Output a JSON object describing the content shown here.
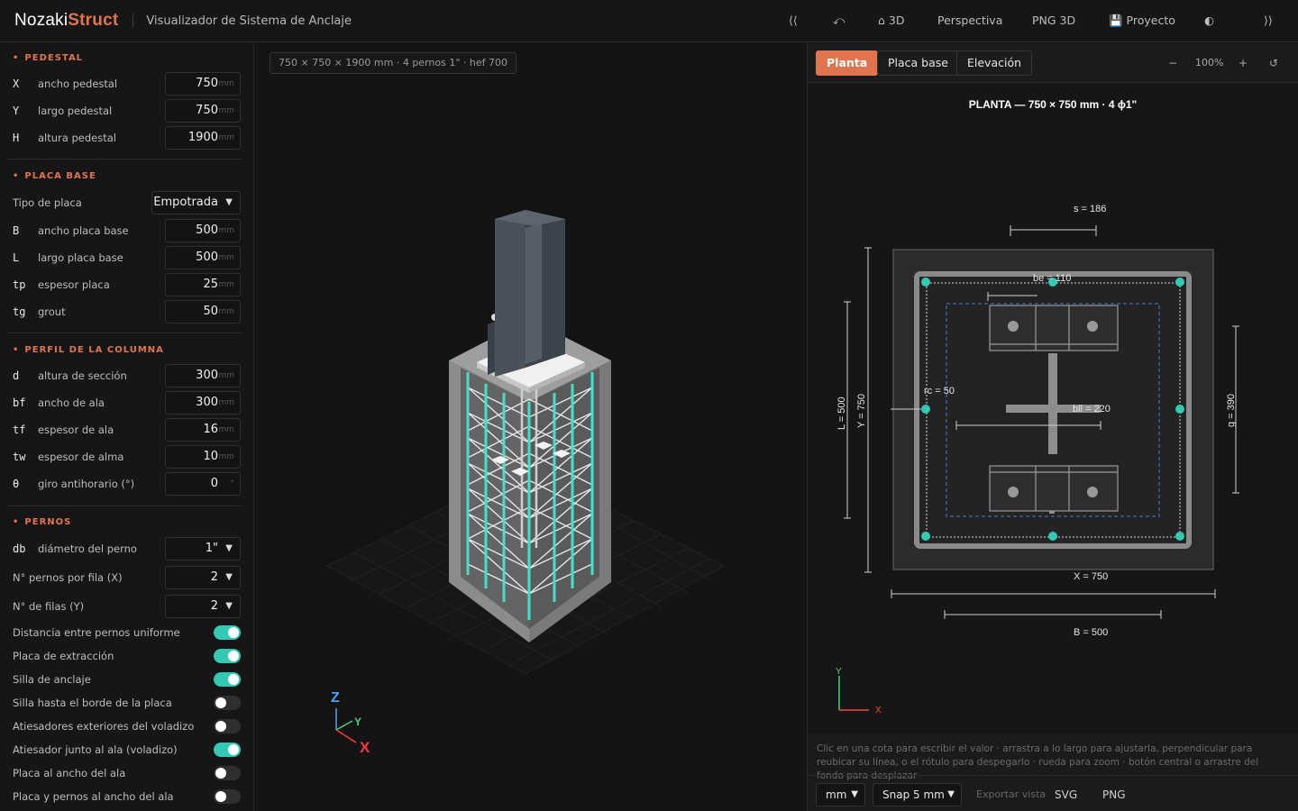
{
  "app": {
    "brand_a": "Nozaki",
    "brand_b": "Struct",
    "subtitle": "Visualizador de Sistema de Anclaje"
  },
  "toolbar": {
    "collapse_left": "⟨⟨",
    "undo": "⤺",
    "view3d": "⌂ 3D",
    "perspective": "Perspectiva",
    "png3d": "PNG 3D",
    "project": "💾 Proyecto",
    "theme": "◐",
    "collapse_right": "⟩⟩"
  },
  "left": {
    "pedestal": {
      "title": "PEDESTAL",
      "rows": [
        {
          "sym": "X",
          "label": "ancho pedestal",
          "value": "750",
          "unit": "mm"
        },
        {
          "sym": "Y",
          "label": "largo pedestal",
          "value": "750",
          "unit": "mm"
        },
        {
          "sym": "H",
          "label": "altura pedestal",
          "value": "1900",
          "unit": "mm"
        }
      ]
    },
    "placa": {
      "title": "PLACA BASE",
      "tipo_label": "Tipo de placa",
      "tipo_value": "Empotrada",
      "rows": [
        {
          "sym": "B",
          "label": "ancho placa base",
          "value": "500",
          "unit": "mm"
        },
        {
          "sym": "L",
          "label": "largo placa base",
          "value": "500",
          "unit": "mm"
        },
        {
          "sym": "tp",
          "label": "espesor placa",
          "value": "25",
          "unit": "mm"
        },
        {
          "sym": "tg",
          "label": "grout",
          "value": "50",
          "unit": "mm"
        }
      ]
    },
    "perfil": {
      "title": "PERFIL DE LA COLUMNA",
      "rows": [
        {
          "sym": "d",
          "label": "altura de sección",
          "value": "300",
          "unit": "mm"
        },
        {
          "sym": "bf",
          "label": "ancho de ala",
          "value": "300",
          "unit": "mm"
        },
        {
          "sym": "tf",
          "label": "espesor de ala",
          "value": "16",
          "unit": "mm"
        },
        {
          "sym": "tw",
          "label": "espesor de alma",
          "value": "10",
          "unit": "mm"
        },
        {
          "sym": "θ",
          "label": "giro antihorario (°)",
          "value": "0",
          "unit": "°"
        }
      ]
    },
    "pernos": {
      "title": "PERNOS",
      "db_sym": "db",
      "db_label": "diámetro del perno",
      "db_value": "1\"",
      "nx_label": "N° pernos por fila (X)",
      "nx_value": "2",
      "ny_label": "N° de filas (Y)",
      "ny_value": "2",
      "toggles": [
        {
          "label": "Distancia entre pernos uniforme",
          "on": true
        },
        {
          "label": "Placa de extracción",
          "on": true
        },
        {
          "label": "Silla de anclaje",
          "on": true
        },
        {
          "label": "Silla hasta el borde de la placa",
          "on": false
        },
        {
          "label": "Atiesadores exteriores del voladizo",
          "on": false
        },
        {
          "label": "Atiesador junto al ala (voladizo)",
          "on": true
        },
        {
          "label": "Placa al ancho del ala",
          "on": false
        },
        {
          "label": "Placa y pernos al ancho del ala",
          "on": false
        }
      ]
    }
  },
  "viewport": {
    "info": "750 × 750 × 1900 mm · 4 pernos 1\" · hef 700",
    "axes": {
      "z": "Z",
      "y": "Y",
      "x": "X"
    }
  },
  "right": {
    "tabs": [
      "Planta",
      "Placa base",
      "Elevación"
    ],
    "zoom_out": "−",
    "zoom": "100%",
    "zoom_in": "+",
    "reset": "↺",
    "drawing_title": "PLANTA — 750 × 750 mm · 4 ϕ1\"",
    "dims": {
      "s": "s = 186",
      "be": "be = 110",
      "rc": "rc = 50",
      "bll": "bll = 220",
      "L": "L = 500",
      "Y": "Y = 750",
      "g": "g = 390",
      "X": "X = 750",
      "B": "B = 500",
      "axis_x": "X",
      "axis_y": "Y"
    },
    "hint": "Clic en una cota para escribir el valor · arrastra a lo largo para ajustarla, perpendicular para reubicar su línea, o el rótulo para despegarlo · rueda para zoom · botón central o arrastre del fondo para desplazar",
    "units_value": "mm",
    "snap_value": "Snap 5 mm",
    "export_label": "Exportar vista",
    "svg_label": "SVG",
    "png_label": "PNG"
  },
  "colors": {
    "accent": "#e0744f",
    "teal": "#34c9b3",
    "blue_dash": "#4a78d6"
  }
}
